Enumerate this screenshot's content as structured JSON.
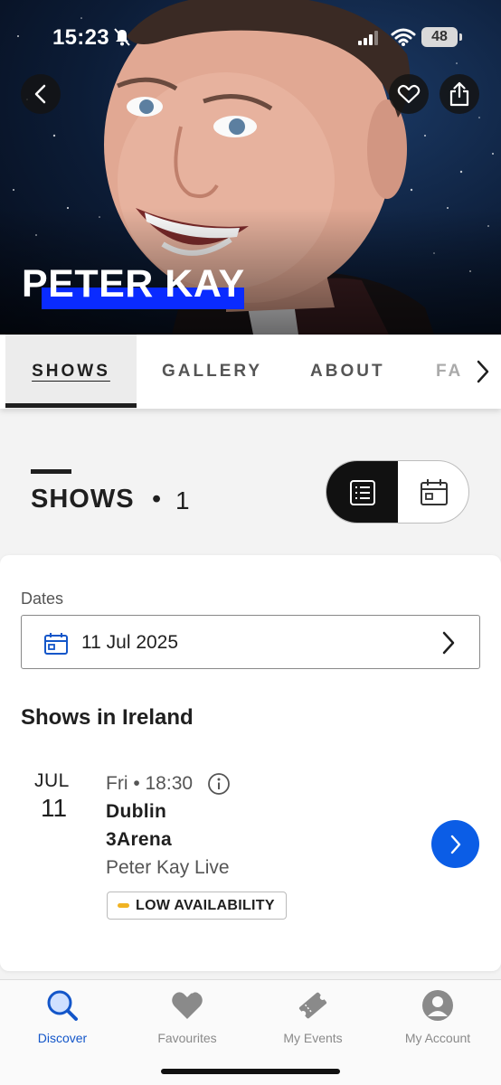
{
  "status_bar": {
    "time": "15:23",
    "battery": "48"
  },
  "hero": {
    "artist_name": "PETER KAY"
  },
  "tabs": [
    {
      "label": "SHOWS",
      "active": true
    },
    {
      "label": "GALLERY",
      "active": false
    },
    {
      "label": "ABOUT",
      "active": false
    },
    {
      "label": "FA",
      "active": false
    }
  ],
  "shows_section": {
    "heading": "SHOWS",
    "separator": "•",
    "count": "1"
  },
  "filters": {
    "dates_label": "Dates",
    "selected_date": "11 Jul 2025"
  },
  "country_section": {
    "title": "Shows in Ireland"
  },
  "events": [
    {
      "month": "JUL",
      "day": "11",
      "weekday_time": "Fri • 18:30",
      "city": "Dublin",
      "venue": "3Arena",
      "name": "Peter Kay Live",
      "availability": "LOW AVAILABILITY"
    }
  ],
  "bottom_nav": [
    {
      "label": "Discover",
      "icon": "discover-search-icon",
      "active": true
    },
    {
      "label": "Favourites",
      "icon": "favourites-heart-icon",
      "active": false
    },
    {
      "label": "My Events",
      "icon": "my-events-ticket-icon",
      "active": false
    },
    {
      "label": "My Account",
      "icon": "account-person-icon",
      "active": false
    }
  ],
  "colors": {
    "brand_blue": "#0b5de6",
    "nav_active": "#1356c9",
    "title_accent": "#0a2bff",
    "availability_low": "#f0b323"
  }
}
